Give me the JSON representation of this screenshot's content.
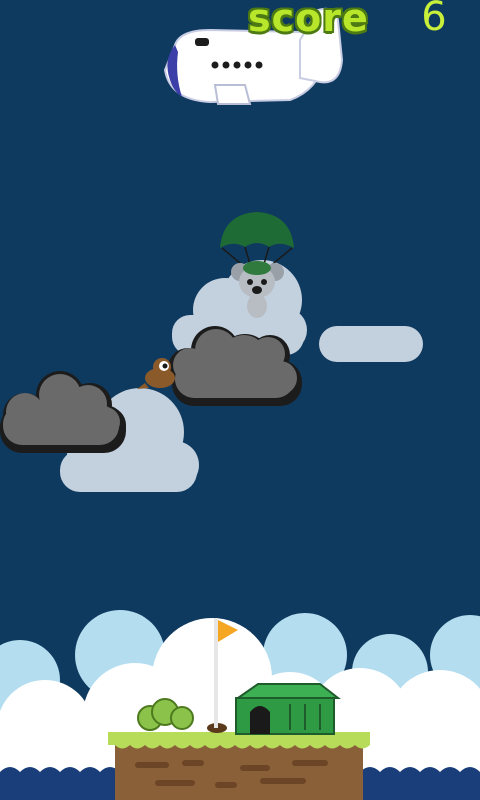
{
  "hud": {
    "score_label": "score",
    "score_value": "6"
  },
  "colors": {
    "sky": "#0f3a5f",
    "cloud_light": "#c3d0de",
    "cloud_dark": "#6a6a6a",
    "parachute": "#1f6b35",
    "score_text": "#b8e62a",
    "flag": "#f5a623",
    "hut": "#2e9a44",
    "ground": "#8a6039",
    "grass": "#b6dc5a",
    "water": "#1a3e7a"
  },
  "sprites": {
    "plane": "airplane-icon",
    "player": "koala-parachute-icon",
    "enemy": "flying-squirrel-icon",
    "goal_flag": "flag-icon",
    "hut": "hut-icon"
  }
}
